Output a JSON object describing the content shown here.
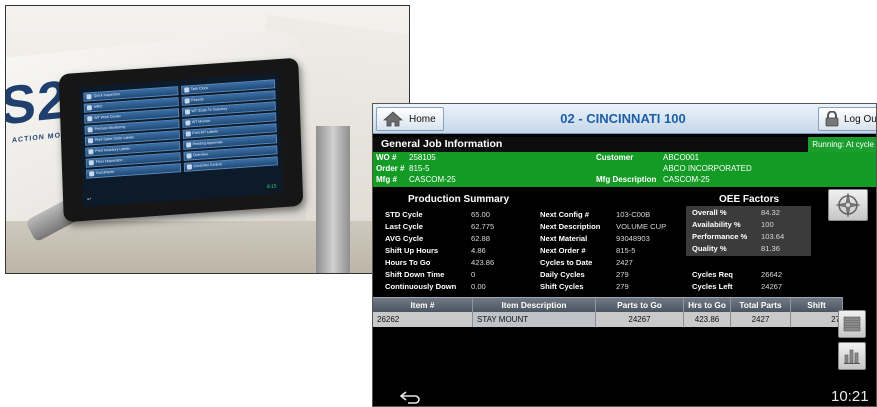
{
  "photo": {
    "logo_text": "S2",
    "logo_sub": "ACTION MOLDI",
    "tablet_menu": [
      "Quick Inspection",
      "Task Clock",
      "MRO",
      "Reports",
      "WT Work Center",
      "WT Scale To Inventory",
      "Process Monitoring",
      "WT Monitor",
      "Print Sales Order Labels",
      "Print WT Labels",
      "Print Inventory Labels",
      "Pending Approvals",
      "Floor Disposition",
      "Overview",
      "Documents",
      "Customer Central"
    ],
    "tablet_clock": "8:15"
  },
  "header": {
    "home_label": "Home",
    "title": "02 - CINCINNATI 100",
    "logout_label": "Log Out"
  },
  "job": {
    "section_title": "General Job Information",
    "running_status": "Running: At cycle",
    "wo_label": "WO #",
    "wo_value": "258105",
    "order_label": "Order #",
    "order_value": "815-5",
    "mfg_label": "Mfg #",
    "mfg_value": "CASCOM-25",
    "customer_label": "Customer",
    "customer_code": "ABCO001",
    "customer_name": "ABCO INCORPORATED",
    "mfg_desc_label": "Mfg Description",
    "mfg_desc_value": "CASCOM-25"
  },
  "production": {
    "title": "Production Summary",
    "left": [
      {
        "label": "STD Cycle",
        "value": "65.00"
      },
      {
        "label": "Last Cycle",
        "value": "62.775"
      },
      {
        "label": "AVG Cycle",
        "value": "62.88"
      },
      {
        "label": "Shift Up Hours",
        "value": "4.86"
      },
      {
        "label": "Hours To Go",
        "value": "423.86"
      },
      {
        "label": "Shift Down Time",
        "value": "0"
      },
      {
        "label": "Continuously Down",
        "value": "0.00"
      }
    ],
    "middle": [
      {
        "label": "Next Config #",
        "value": "103-C00B"
      },
      {
        "label": "Next Description",
        "value": "VOLUME CUP"
      },
      {
        "label": "Next Material",
        "value": "93048903"
      },
      {
        "label": "Next Order #",
        "value": "815-5"
      },
      {
        "label": "Cycles to Date",
        "value": "2427"
      },
      {
        "label": "Daily Cycles",
        "value": "279"
      },
      {
        "label": "Shift Cycles",
        "value": "279"
      }
    ]
  },
  "oee": {
    "title": "OEE Factors",
    "rows": [
      {
        "label": "Overall %",
        "value": "84.32"
      },
      {
        "label": "Availability %",
        "value": "100"
      },
      {
        "label": "Performance %",
        "value": "103.64"
      },
      {
        "label": "Quality %",
        "value": "81.36"
      }
    ],
    "cycles_req_label": "Cycles Req",
    "cycles_req_value": "26642",
    "cycles_left_label": "Cycles Left",
    "cycles_left_value": "24267"
  },
  "table": {
    "headers": [
      "Item #",
      "Item Description",
      "Parts to Go",
      "Hrs to Go",
      "Total Parts",
      "Shift"
    ],
    "row": [
      "26262",
      "STAY MOUNT",
      "24267",
      "423.86",
      "2427",
      "27"
    ]
  },
  "footer": {
    "clock": "10:21"
  },
  "colors": {
    "green_bar": "#149b25",
    "title_blue": "#1d5fa8",
    "table_header": "#4b5560"
  }
}
